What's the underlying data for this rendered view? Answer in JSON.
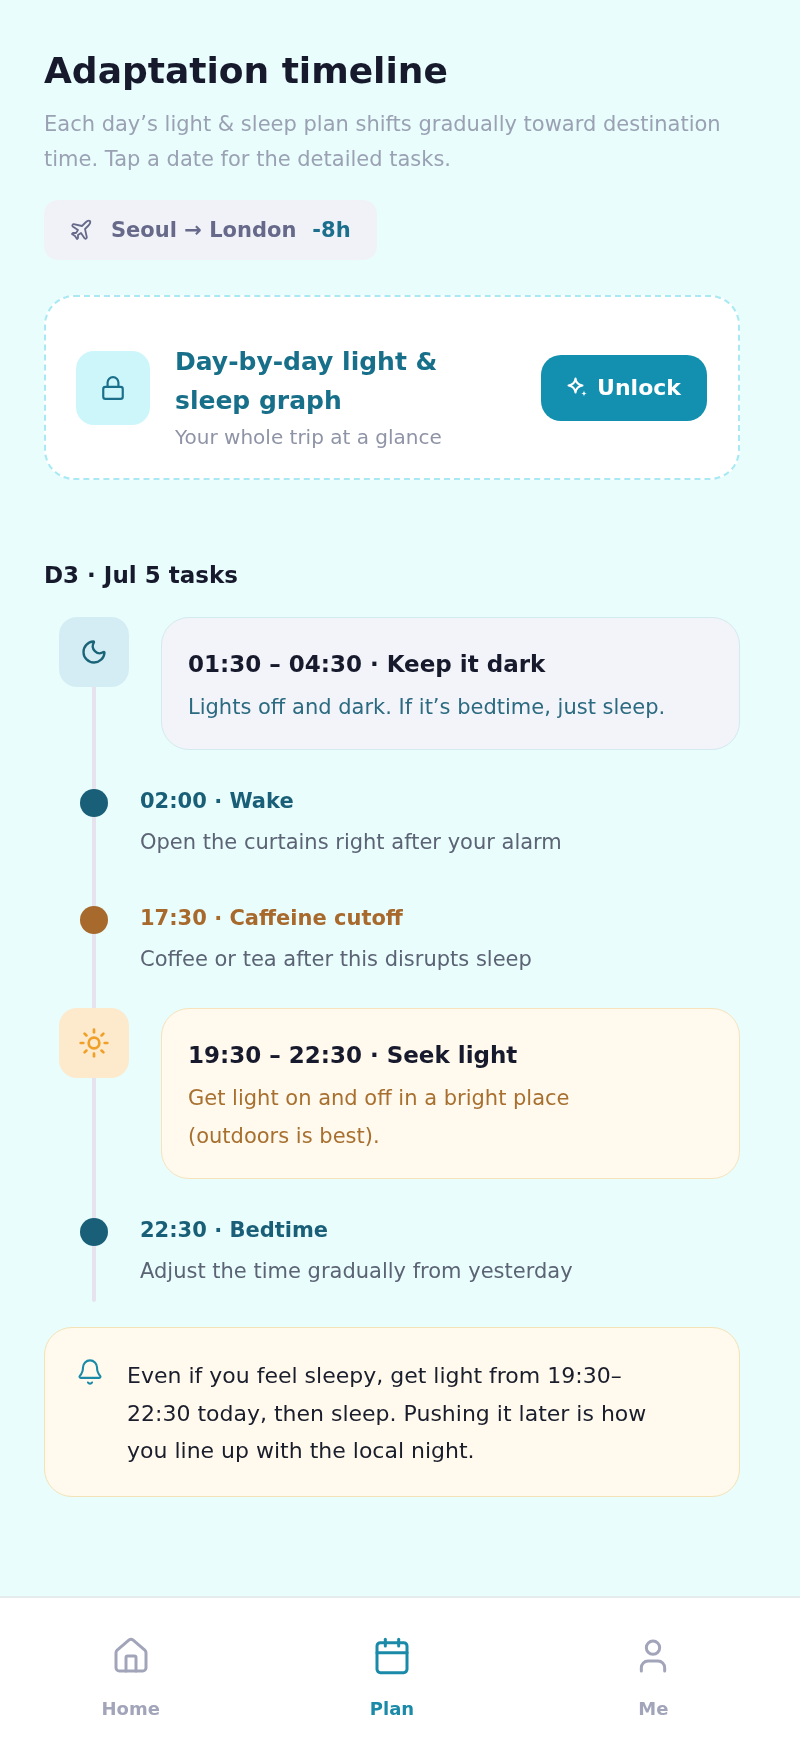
{
  "header": {
    "title": "Adaptation timeline",
    "subtitle": "Each day’s light & sleep plan shifts gradually toward destination time. Tap a date for the detailed tasks."
  },
  "route": {
    "label": "Seoul → London",
    "offset": "-8h"
  },
  "upsell": {
    "title": "Day-by-day light & sleep graph",
    "subtitle": "Your whole trip at a glance",
    "button": "Unlock"
  },
  "tasks": {
    "heading": "D3 · Jul 5 tasks",
    "items": [
      {
        "kind": "night",
        "title": "01:30 – 04:30 · Keep it dark",
        "description": "Lights off and dark. If it’s bedtime, just sleep."
      },
      {
        "kind": "event",
        "color": "#1a5f78",
        "title": "02:00 · Wake",
        "description": "Open the curtains right after your alarm"
      },
      {
        "kind": "event",
        "color": "#a8692c",
        "title": "17:30 · Caffeine cutoff",
        "description": "Coffee or tea after this disrupts sleep"
      },
      {
        "kind": "daylight",
        "title": "19:30 – 22:30 · Seek light",
        "description": "Get light on and off in a bright place (outdoors is best)."
      },
      {
        "kind": "event",
        "color": "#1a5f78",
        "title": "22:30 · Bedtime",
        "description": "Adjust the time gradually from yesterday"
      }
    ]
  },
  "tip": {
    "text": "Even if you feel sleepy, get light from 19:30–22:30 today, then sleep. Pushing it later is how you line up with the local night."
  },
  "bottom_nav": [
    {
      "label": "Home",
      "selected": false
    },
    {
      "label": "Plan",
      "selected": true
    },
    {
      "label": "Me",
      "selected": false
    }
  ]
}
